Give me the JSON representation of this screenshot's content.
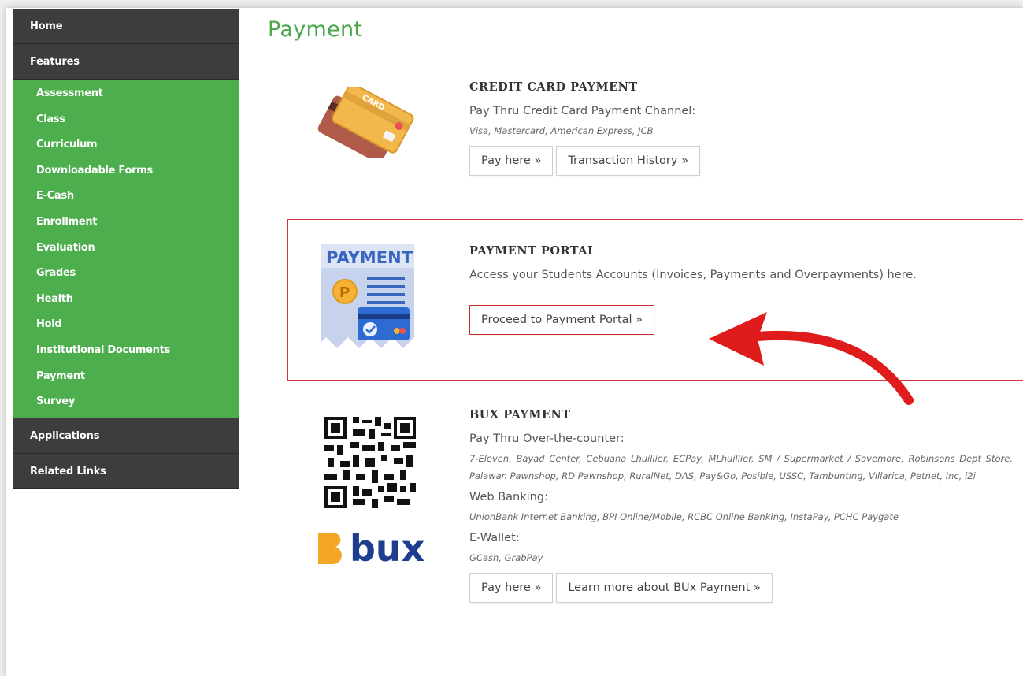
{
  "sidebar": {
    "home": "Home",
    "features": "Features",
    "features_items": [
      "Assessment",
      "Class",
      "Curriculum",
      "Downloadable Forms",
      "E-Cash",
      "Enrollment",
      "Evaluation",
      "Grades",
      "Health",
      "Hold",
      "Institutional Documents",
      "Payment",
      "Survey"
    ],
    "applications": "Applications",
    "related_links": "Related Links"
  },
  "page_title": "Payment",
  "credit_card": {
    "title": "CREDIT CARD PAYMENT",
    "desc": "Pay Thru Credit Card Payment Channel:",
    "cards": "Visa, Mastercard, American Express, JCB",
    "pay_btn": "Pay here »",
    "history_btn": "Transaction History »",
    "icon_text": "CARD"
  },
  "portal": {
    "title": "PAYMENT PORTAL",
    "desc": "Access your Students Accounts (Invoices, Payments and Overpayments) here.",
    "btn": "Proceed to Payment Portal »",
    "icon_text": "PAYMENT",
    "coin_text": "P"
  },
  "bux": {
    "title": "BUX PAYMENT",
    "otc_label": "Pay Thru Over-the-counter:",
    "otc_list": "7-Eleven, Bayad Center, Cebuana Lhuillier, ECPay, MLhuillier, SM / Supermarket / Savemore, Robinsons Dept Store, Palawan Pawnshop, RD Pawnshop, RuralNet, DAS, Pay&Go, Posible, USSC, Tambunting, Villarica, Petnet, Inc, i2i",
    "web_label": "Web Banking:",
    "web_list": "UnionBank Internet Banking, BPI Online/Mobile, RCBC Online Banking, InstaPay, PCHC Paygate",
    "ewallet_label": "E-Wallet:",
    "ewallet_list": "GCash, GrabPay",
    "pay_btn": "Pay here »",
    "learn_btn": "Learn more about BUx Payment »",
    "logo_text": "bux"
  },
  "colors": {
    "sidebar_dark": "#3d3d3d",
    "sidebar_green": "#4cae4c",
    "title_green": "#4aa84a",
    "highlight_red": "#d9373b",
    "arrow_red": "#e01b1b",
    "bux_blue": "#1e3d8f",
    "bux_orange": "#f5a623"
  },
  "icons": [
    "credit-card-icon",
    "payment-receipt-icon",
    "qr-code-icon",
    "bux-logo-icon",
    "arrow-icon"
  ]
}
